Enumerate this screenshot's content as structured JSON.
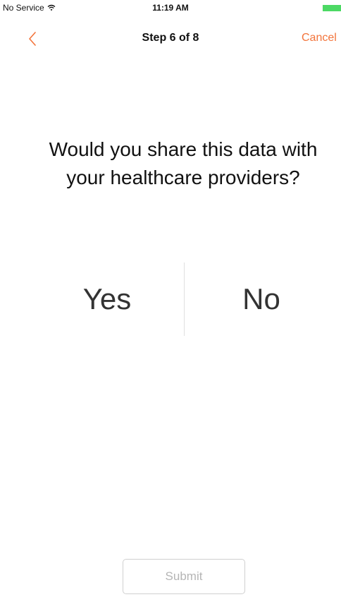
{
  "status_bar": {
    "carrier": "No Service",
    "time": "11:19 AM",
    "battery_color": "#4cd964",
    "wifi_icon": "wifi-icon",
    "battery_icon": "battery-icon"
  },
  "nav": {
    "title": "Step 6 of 8",
    "back_icon": "chevron-left-icon",
    "cancel_label": "Cancel",
    "accent_color": "#f3743b"
  },
  "question": {
    "text": "Would you share this data with your healthcare providers?"
  },
  "choices": {
    "yes_label": "Yes",
    "no_label": "No"
  },
  "footer": {
    "submit_label": "Submit",
    "submit_enabled": false
  }
}
